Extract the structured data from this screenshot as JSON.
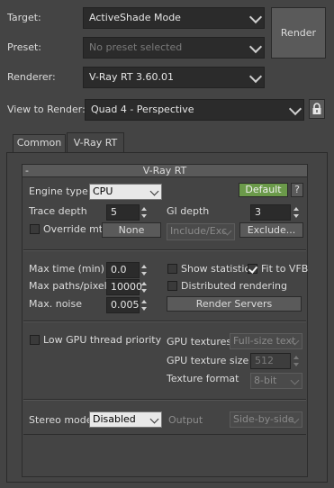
{
  "top": {
    "target_label": "Target:",
    "target_value": "ActiveShade Mode",
    "preset_label": "Preset:",
    "preset_value": "No preset selected",
    "renderer_label": "Renderer:",
    "renderer_value": "V-Ray RT 3.60.01",
    "view_label": "View to Render:",
    "view_value": "Quad 4 - Perspective",
    "render_button": "Render",
    "lock_icon": "lock-icon"
  },
  "tabs": [
    {
      "label": "Common",
      "active": false
    },
    {
      "label": "V-Ray RT",
      "active": true
    }
  ],
  "rollout": {
    "collapse_symbol": "-",
    "title": "V-Ray RT"
  },
  "engine": {
    "engine_type_label": "Engine type",
    "engine_type_value": "CPU",
    "default_button": "Default",
    "help_button": "?",
    "trace_depth_label": "Trace depth",
    "trace_depth_value": "5",
    "gi_depth_label": "GI depth",
    "gi_depth_value": "3",
    "override_mtl_label": "Override mtl",
    "override_mtl_checked": false,
    "none_button": "None",
    "include_exclude_value": "Include/Exc",
    "exclude_button": "Exclude..."
  },
  "limits": {
    "max_time_label": "Max time (min)",
    "max_time_value": "0.0",
    "max_paths_label": "Max paths/pixel",
    "max_paths_value": "10000",
    "max_noise_label": "Max. noise",
    "max_noise_value": "0.005",
    "show_statistics_label": "Show statistics",
    "show_statistics_checked": false,
    "fit_to_vfb_label": "Fit to VFB",
    "fit_to_vfb_checked": true,
    "distributed_label": "Distributed rendering",
    "distributed_checked": false,
    "render_servers_button": "Render Servers"
  },
  "gpu": {
    "low_priority_label": "Low GPU thread priority",
    "low_priority_checked": false,
    "gpu_textures_label": "GPU textures",
    "gpu_textures_value": "Full-size text",
    "gpu_texture_size_label": "GPU texture size",
    "gpu_texture_size_value": "512",
    "texture_format_label": "Texture format",
    "texture_format_value": "8-bit"
  },
  "stereo": {
    "stereo_mode_label": "Stereo mode",
    "stereo_mode_value": "Disabled",
    "output_label": "Output",
    "output_value": "Side-by-side"
  }
}
